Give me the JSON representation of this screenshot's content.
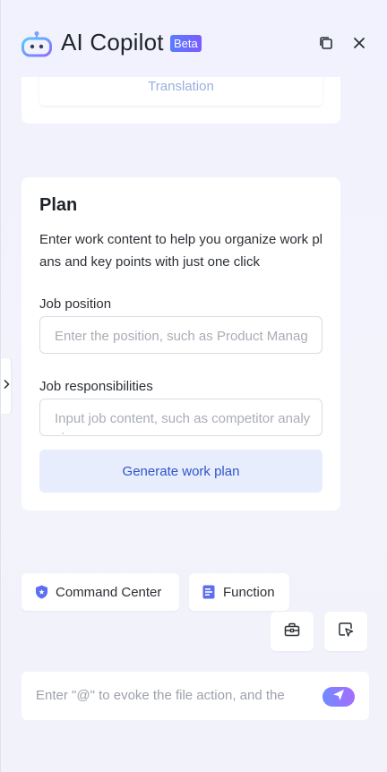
{
  "header": {
    "title": "AI Copilot",
    "badge": "Beta"
  },
  "translation_card": {
    "button_label": "Translation"
  },
  "plan": {
    "title": "Plan",
    "description": "Enter work content to help you organize work plans and key points with just one click",
    "job_position": {
      "label": "Job position",
      "placeholder": "Enter the position, such as Product Manager"
    },
    "job_responsibilities": {
      "label": "Job responsibilities",
      "placeholder": "Input job content, such as competitor analysis"
    },
    "generate_label": "Generate work plan"
  },
  "chips": {
    "command_center": "Command Center",
    "function": "Function"
  },
  "input": {
    "placeholder": "Enter \"@\" to evoke the file action, and the"
  },
  "colors": {
    "accent": "#2f55c7",
    "badge": "#6a6cff",
    "shield": "#5b6ff0"
  }
}
